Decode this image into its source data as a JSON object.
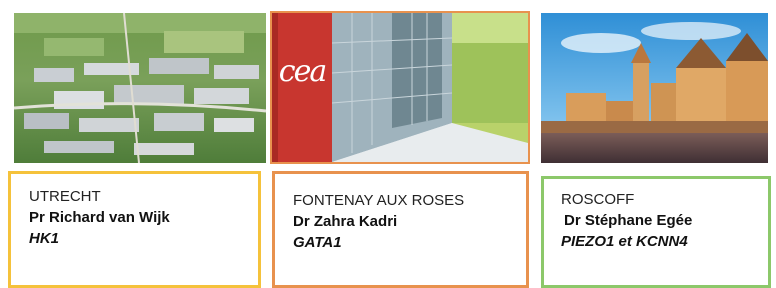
{
  "colors": {
    "utrecht_border": "#f5c23b",
    "fontenay_border": "#e8924e",
    "fontenay_photo_border": "#e8924e",
    "roscoff_border": "#8cc86a"
  },
  "photos": {
    "utrecht": {
      "subject": "aerial-campus-photo"
    },
    "fontenay": {
      "subject": "cea-building-photo",
      "logo_text": "cea"
    },
    "roscoff": {
      "subject": "seaside-town-photo"
    }
  },
  "cards": [
    {
      "city": "UTRECHT",
      "person": "Pr Richard van Wijk",
      "gene": "HK1"
    },
    {
      "city": "FONTENAY AUX ROSES",
      "person": "Dr Zahra Kadri",
      "gene": "GATA1"
    },
    {
      "city": "ROSCOFF",
      "person": "Dr Stéphane Egée",
      "gene": "PIEZO1 et KCNN4"
    }
  ]
}
